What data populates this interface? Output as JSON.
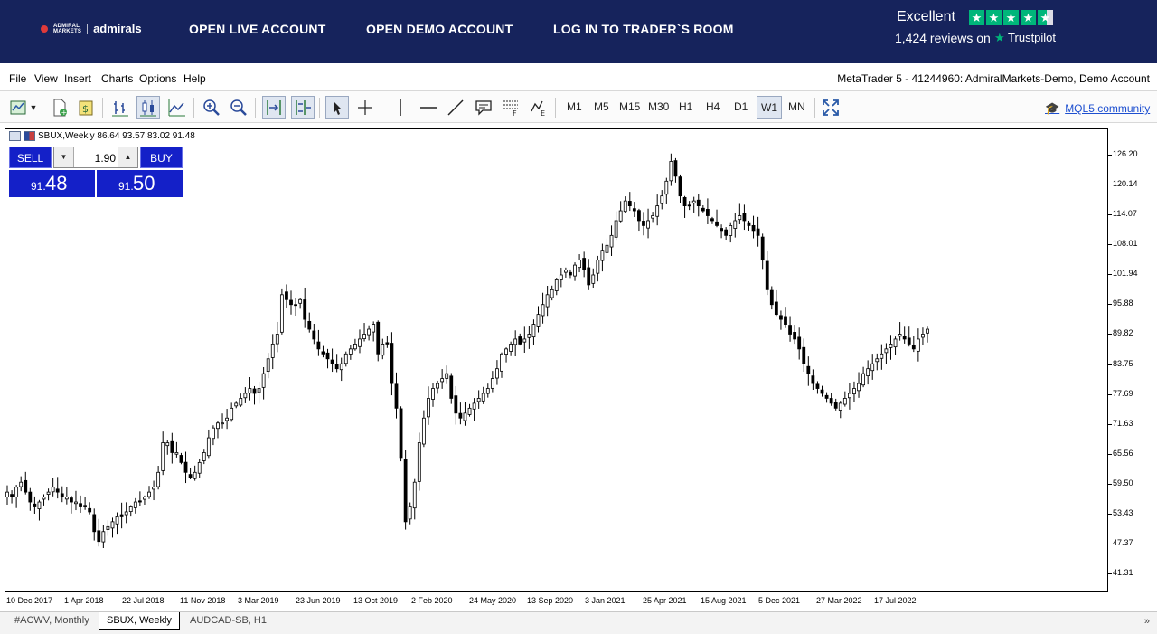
{
  "banner": {
    "logo_small_top": "ADMIRAL",
    "logo_small_bottom": "MARKETS",
    "logo_brand": "admirals",
    "nav": [
      "OPEN LIVE ACCOUNT",
      "OPEN DEMO ACCOUNT",
      "LOG IN TO TRADER`S ROOM"
    ],
    "trustpilot_rating": "Excellent",
    "trustpilot_reviews": "1,424 reviews on",
    "trustpilot_name": "Trustpilot",
    "trustpilot_color": "#00b67a",
    "background": "#16235c"
  },
  "menu": {
    "items": [
      "File",
      "View",
      "Insert",
      "Charts",
      "Options",
      "Help"
    ],
    "account_info": "MetaTrader 5 - 41244960: AdmiralMarkets-Demo, Demo Account"
  },
  "toolbar": {
    "icons": [
      "new-chart-icon",
      "dropdown-arrow-icon",
      "new-order-icon",
      "trade-icon",
      "bar-chart-icon",
      "candlestick-icon",
      "line-chart-icon",
      "zoom-in-icon",
      "zoom-out-icon",
      "autoscroll-icon",
      "chart-shift-icon",
      "cursor-icon",
      "crosshair-icon",
      "vertical-line-icon",
      "horizontal-line-icon",
      "trendline-icon",
      "text-icon",
      "fibonacci-icon",
      "elliott-icon",
      "fullscreen-icon",
      "mql5-community-icon"
    ],
    "timeframes": [
      "M1",
      "M5",
      "M15",
      "M30",
      "H1",
      "H4",
      "D1",
      "W1",
      "MN"
    ],
    "active_timeframe": "W1",
    "mql5_link": "MQL5.community"
  },
  "chart": {
    "symbol_line": "SBUX,Weekly  86.64 93.57 83.02 91.48",
    "trade": {
      "sell_label": "SELL",
      "buy_label": "BUY",
      "lot": "1.90",
      "sell_price_small": "91.",
      "sell_price_big": "48",
      "buy_price_small": "91.",
      "buy_price_big": "50",
      "button_color": "#1420c8"
    }
  },
  "chart_data": {
    "type": "candlestick",
    "symbol": "SBUX",
    "timeframe": "Weekly",
    "ohlc_last": {
      "open": 86.64,
      "high": 93.57,
      "low": 83.02,
      "close": 91.48
    },
    "ylim": [
      37.5,
      131.5
    ],
    "y_ticks": [
      "126.20",
      "120.14",
      "114.07",
      "108.01",
      "101.94",
      "95.88",
      "89.82",
      "83.75",
      "77.69",
      "71.63",
      "65.56",
      "59.50",
      "53.43",
      "47.37",
      "41.31"
    ],
    "y_tick_values": [
      126.2,
      120.14,
      114.07,
      108.01,
      101.94,
      95.88,
      89.82,
      83.75,
      77.69,
      71.63,
      65.56,
      59.5,
      53.43,
      47.37,
      41.31
    ],
    "x_ticks": [
      "10 Dec 2017",
      "1 Apr 2018",
      "22 Jul 2018",
      "11 Nov 2018",
      "3 Mar 2019",
      "23 Jun 2019",
      "13 Oct 2019",
      "2 Feb 2020",
      "24 May 2020",
      "13 Sep 2020",
      "3 Jan 2021",
      "25 Apr 2021",
      "15 Aug 2021",
      "5 Dec 2021",
      "27 Mar 2022",
      "17 Jul 2022"
    ],
    "close_path": [
      58,
      57,
      59,
      60,
      58,
      56,
      55,
      56,
      57,
      58,
      59,
      58,
      57,
      57,
      56,
      56,
      55,
      55,
      54,
      50,
      48,
      50,
      51,
      52,
      53,
      53,
      54,
      55,
      56,
      56,
      57,
      58,
      59,
      62,
      68,
      68,
      66,
      66,
      64,
      62,
      61,
      62,
      64,
      66,
      69,
      71,
      72,
      72,
      73,
      75,
      76,
      77,
      78,
      79,
      78,
      79,
      82,
      85,
      88,
      90,
      98,
      97,
      96,
      96,
      97,
      93,
      91,
      89,
      87,
      86,
      85,
      84,
      83,
      84,
      86,
      87,
      88,
      89,
      90,
      91,
      92,
      86,
      88,
      88,
      80,
      75,
      65,
      52,
      55,
      60,
      68,
      73,
      77,
      79,
      80,
      81,
      82,
      77,
      74,
      73,
      74,
      75,
      76,
      77,
      78,
      79,
      81,
      83,
      86,
      87,
      88,
      89,
      88,
      89,
      90,
      92,
      94,
      96,
      98,
      99,
      101,
      102,
      103,
      102,
      104,
      105,
      103,
      100,
      102,
      105,
      107,
      108,
      110,
      113,
      115,
      117,
      116,
      115,
      113,
      112,
      113,
      114,
      116,
      118,
      121,
      125,
      122,
      118,
      116,
      116,
      117,
      116,
      115,
      114,
      113,
      112,
      111,
      110,
      112,
      113,
      114,
      113,
      112,
      111,
      110,
      105,
      99,
      96,
      94,
      93,
      92,
      90,
      89,
      87,
      84,
      82,
      80,
      79,
      78,
      77,
      76,
      75,
      76,
      77,
      78,
      79,
      80,
      82,
      83,
      84,
      85,
      86,
      87,
      88,
      89,
      90,
      89,
      88,
      87,
      89,
      90,
      91
    ]
  },
  "tabs": {
    "items": [
      "#ACWV, Monthly",
      "SBUX, Weekly",
      "AUDCAD-SB, H1"
    ],
    "active": "SBUX, Weekly",
    "scroll_arrow": "»"
  }
}
